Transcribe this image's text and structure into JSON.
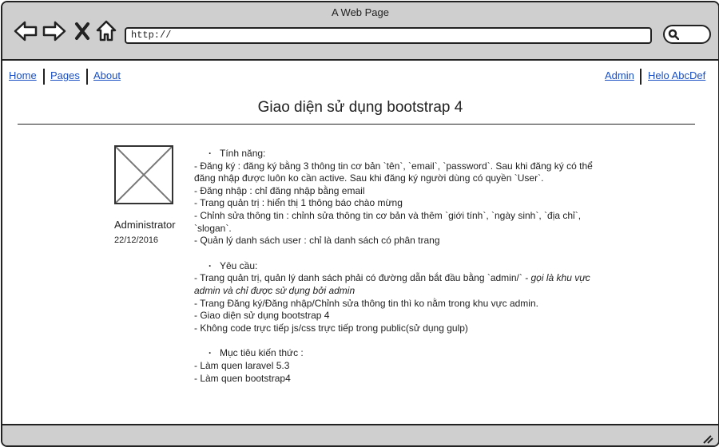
{
  "window": {
    "title": "A Web Page"
  },
  "browser": {
    "url": "http://"
  },
  "nav": {
    "left": [
      {
        "label": "Home"
      },
      {
        "label": "Pages"
      },
      {
        "label": "About"
      }
    ],
    "right": [
      {
        "label": "Admin"
      },
      {
        "label": "Helo AbcDef"
      }
    ]
  },
  "page": {
    "title": "Giao diện sử dụng bootstrap 4"
  },
  "profile": {
    "name": "Administrator",
    "date": "22/12/2016"
  },
  "content": {
    "features_heading": "Tính năng:",
    "features": [
      "- Đăng ký : đăng ký bằng 3 thông tin cơ bản `tên`, `email`, `password`. Sau khi đăng ký có thể đăng nhập được luôn ko cần active. Sau khi đăng ký người dùng có quyền `User`.",
      "- Đăng nhập : chỉ đăng nhập bằng email",
      "- Trang quản trị : hiển thị 1 thông báo chào mừng",
      "- Chỉnh sửa thông tin : chỉnh sửa thông tin cơ bản và thêm `giới tính`, `ngày sinh`, `địa chỉ`, `slogan`.",
      "- Quản lý danh sách user : chỉ là danh sách có phân trang"
    ],
    "req_heading": "Yêu cầu:",
    "req_line1_plain": "- Trang quản trị, quản lý danh sách phải có đường dẫn bắt đầu bằng `admin/` ",
    "req_line1_italic": "- gọi là khu vực admin và chỉ được sử dụng bởi admin",
    "requirements": [
      "- Trang Đăng ký/Đăng nhập/Chỉnh sửa thông tin thì ko nằm trong khu vực admin.",
      "- Giao diện sử dụng bootstrap 4",
      "- Không code trực tiếp js/css trực tiếp trong public(sử dụng gulp)"
    ],
    "goals_heading": "Mục tiêu kiến thức :",
    "goals": [
      "- Làm quen laravel 5.3",
      "- Làm quen bootstrap4"
    ]
  }
}
